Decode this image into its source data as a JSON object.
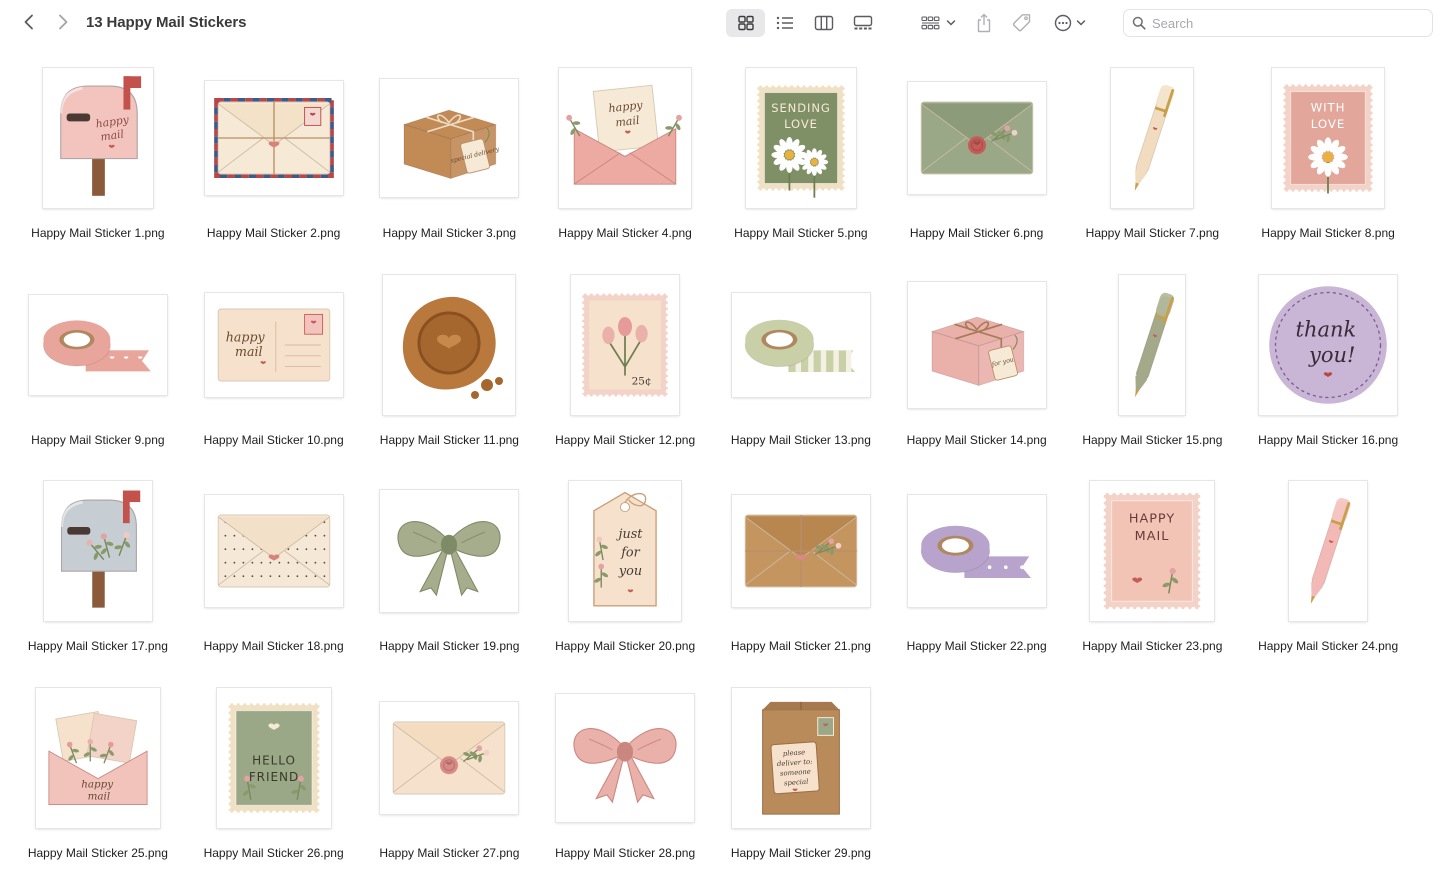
{
  "window": {
    "title": "13 Happy Mail Stickers"
  },
  "toolbar": {
    "back_icon": "chevron-left-icon",
    "forward_icon": "chevron-right-icon",
    "views": [
      {
        "name": "icon-view",
        "icon": "grid-icon",
        "active": true
      },
      {
        "name": "list-view",
        "icon": "list-icon",
        "active": false
      },
      {
        "name": "column-view",
        "icon": "columns-icon",
        "active": false
      },
      {
        "name": "gallery-view",
        "icon": "gallery-icon",
        "active": false
      }
    ],
    "group_icon": "group-by-icon",
    "share_icon": "share-icon",
    "tag_icon": "tag-icon",
    "more_icon": "ellipsis-circle-icon"
  },
  "search": {
    "placeholder": "Search",
    "value": ""
  },
  "files": [
    {
      "name": "Happy Mail Sticker 1.png",
      "subject": "pink mailbox",
      "text": "happy mail"
    },
    {
      "name": "Happy Mail Sticker 2.png",
      "subject": "airmail envelope",
      "text": ""
    },
    {
      "name": "Happy Mail Sticker 3.png",
      "subject": "kraft parcel with tag",
      "text": "special delivery"
    },
    {
      "name": "Happy Mail Sticker 4.png",
      "subject": "open pink envelope with card",
      "text": "happy mail"
    },
    {
      "name": "Happy Mail Sticker 5.png",
      "subject": "green daisy stamp",
      "text": "SENDING LOVE"
    },
    {
      "name": "Happy Mail Sticker 6.png",
      "subject": "sage envelope with wax seal",
      "text": ""
    },
    {
      "name": "Happy Mail Sticker 7.png",
      "subject": "cream pen",
      "text": ""
    },
    {
      "name": "Happy Mail Sticker 8.png",
      "subject": "pink daisy stamp",
      "text": "WITH LOVE"
    },
    {
      "name": "Happy Mail Sticker 9.png",
      "subject": "pink washi tape",
      "text": ""
    },
    {
      "name": "Happy Mail Sticker 10.png",
      "subject": "postcard",
      "text": "happy mail"
    },
    {
      "name": "Happy Mail Sticker 11.png",
      "subject": "bronze wax seal",
      "text": ""
    },
    {
      "name": "Happy Mail Sticker 12.png",
      "subject": "tulip stamp",
      "text": "25¢"
    },
    {
      "name": "Happy Mail Sticker 13.png",
      "subject": "gingham washi tape",
      "text": ""
    },
    {
      "name": "Happy Mail Sticker 14.png",
      "subject": "pink gift box",
      "text": "for you"
    },
    {
      "name": "Happy Mail Sticker 15.png",
      "subject": "sage pen",
      "text": ""
    },
    {
      "name": "Happy Mail Sticker 16.png",
      "subject": "lavender round sticker",
      "text": "thank you!"
    },
    {
      "name": "Happy Mail Sticker 17.png",
      "subject": "grey mailbox",
      "text": ""
    },
    {
      "name": "Happy Mail Sticker 18.png",
      "subject": "dotted envelope",
      "text": ""
    },
    {
      "name": "Happy Mail Sticker 19.png",
      "subject": "sage bow",
      "text": ""
    },
    {
      "name": "Happy Mail Sticker 20.png",
      "subject": "gift tag",
      "text": "just for you"
    },
    {
      "name": "Happy Mail Sticker 21.png",
      "subject": "kraft envelope with twine",
      "text": ""
    },
    {
      "name": "Happy Mail Sticker 22.png",
      "subject": "lavender washi tape",
      "text": ""
    },
    {
      "name": "Happy Mail Sticker 23.png",
      "subject": "pink stamp",
      "text": "HAPPY MAIL"
    },
    {
      "name": "Happy Mail Sticker 24.png",
      "subject": "pink pen",
      "text": ""
    },
    {
      "name": "Happy Mail Sticker 25.png",
      "subject": "envelope with letters",
      "text": "happy mail"
    },
    {
      "name": "Happy Mail Sticker 26.png",
      "subject": "sage stamp",
      "text": "HELLO FRIEND"
    },
    {
      "name": "Happy Mail Sticker 27.png",
      "subject": "cream envelope with seal",
      "text": ""
    },
    {
      "name": "Happy Mail Sticker 28.png",
      "subject": "pink bow",
      "text": ""
    },
    {
      "name": "Happy Mail Sticker 29.png",
      "subject": "kraft paper bag",
      "text": "please deliver to: someone special"
    }
  ]
}
